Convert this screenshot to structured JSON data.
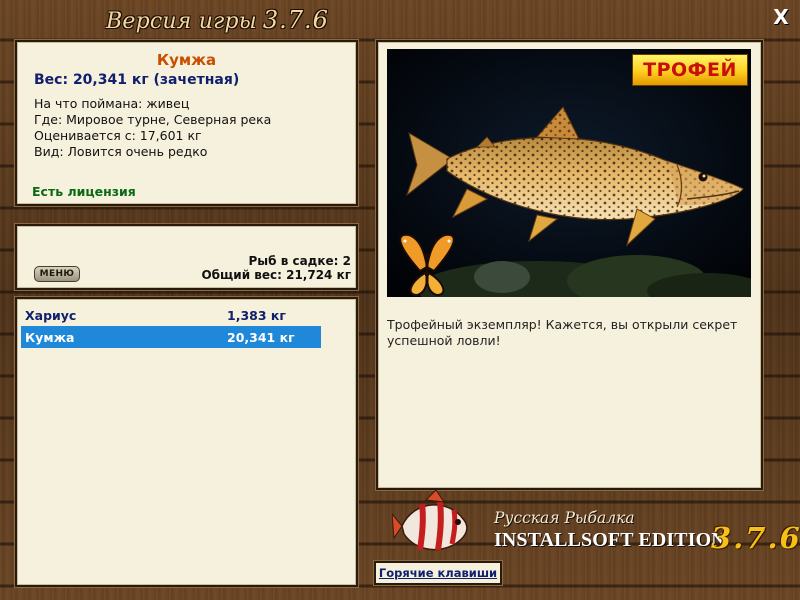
{
  "window": {
    "title": "Версия игры",
    "version": "3.7.6",
    "close_label": "X"
  },
  "fish_info": {
    "name": "Кумжа",
    "weight": "Вес: 20,341 кг (зачетная)",
    "caught_on": "На что поймана: живец",
    "location": "Где: Мировое турне, Северная река",
    "valued_from": "Оценивается с: 17,601 кг",
    "type": "Вид: Ловится очень редко",
    "license": "Есть лицензия"
  },
  "cage": {
    "menu_label": "МЕНЮ",
    "fish_count": "Рыб в садке: 2",
    "total_weight": "Общий вес: 21,724 кг"
  },
  "catch_list": [
    {
      "name": "Хариус",
      "weight": "1,383 кг",
      "selected": false
    },
    {
      "name": "Кумжа",
      "weight": "20,341 кг",
      "selected": true
    }
  ],
  "right_panel": {
    "trophy_label": "ТРОФЕЙ",
    "message": "Трофейный экземпляр! Кажется, вы открыли секрет успешной ловли!"
  },
  "logo": {
    "line1": "Русская Рыбалка",
    "line2": "INSTALLSOFT EDITION",
    "version": "3.7.6"
  },
  "hotkeys_label": "Горячие клавиши",
  "colors": {
    "panel_bg": "#f6f1dc",
    "fish_name": "#c84e00",
    "weight_text": "#10206e",
    "license_text": "#0a6a14",
    "selection": "#1f88d8",
    "trophy_text": "#c8100a"
  }
}
